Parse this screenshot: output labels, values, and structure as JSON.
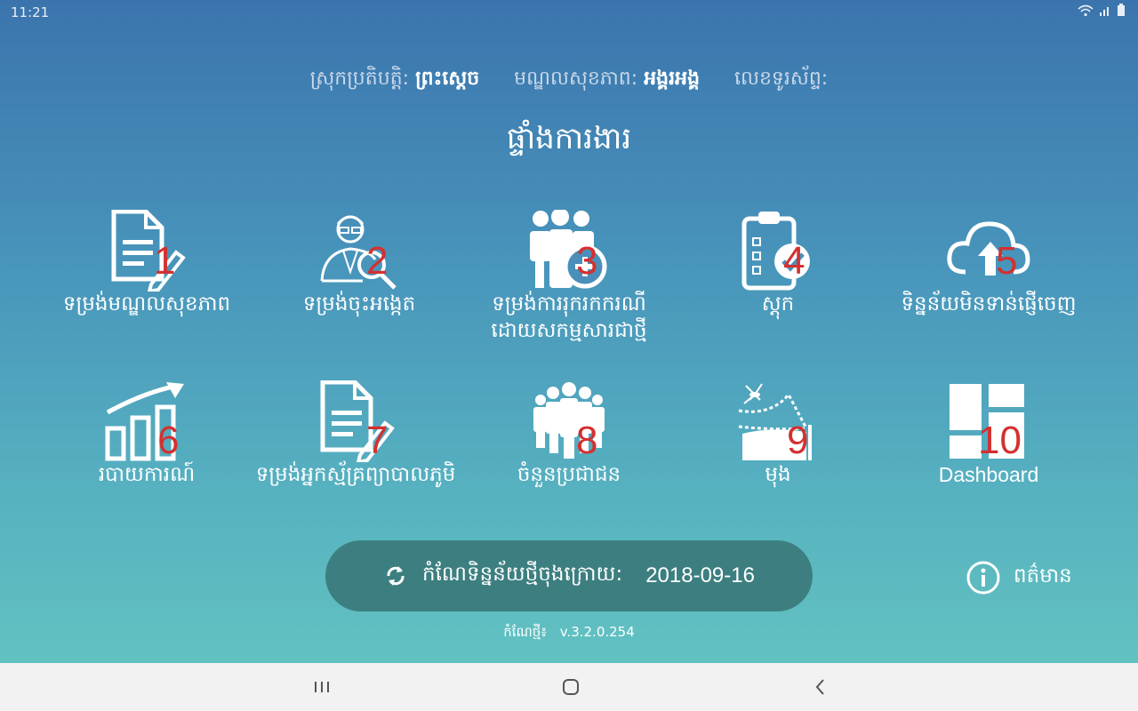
{
  "status_bar": {
    "time": "11:21",
    "icons": [
      "wifi-icon",
      "signal-icon",
      "battery-icon"
    ]
  },
  "info": {
    "district_label": "ស្រុកប្រតិបត្តិ:",
    "district_value": "ព្រះស្ដេច",
    "health_center_label": "មណ្ឌលសុខភាព:",
    "health_center_value": "អង្គរអង្គ",
    "phone_label": "លេខទូរស័ព្ទ:"
  },
  "title": "ផ្ទាំងការងារ",
  "tiles": [
    {
      "number": "1",
      "label": "ទម្រង់មណ្ឌលសុខភាព",
      "icon": "document-edit-icon"
    },
    {
      "number": "2",
      "label": "ទម្រង់ចុះអង្កេត",
      "icon": "investigator-icon"
    },
    {
      "number": "3",
      "label": "ទម្រង់ការរុករកករណីដោយសកម្មសារជាថ្មី",
      "icon": "group-add-icon"
    },
    {
      "number": "4",
      "label": "ស្តុក",
      "icon": "clipboard-check-icon"
    },
    {
      "number": "5",
      "label": "ទិន្នន័យមិនទាន់ផ្ញើចេញ",
      "icon": "cloud-upload-icon"
    },
    {
      "number": "6",
      "label": "របាយការណ៍",
      "icon": "bar-chart-trend-icon"
    },
    {
      "number": "7",
      "label": "ទម្រង់អ្នកស្ម័គ្រព្យាបាលភូមិ",
      "icon": "document-edit-icon"
    },
    {
      "number": "8",
      "label": "ចំនួនប្រជាជន",
      "icon": "people-icon"
    },
    {
      "number": "9",
      "label": "មុង",
      "icon": "mosquito-net-icon"
    },
    {
      "number": "10",
      "label": "Dashboard",
      "icon": "dashboard-icon"
    }
  ],
  "sync": {
    "label": "កំណែទិន្នន័យថ្មីចុងក្រោយ:",
    "date": "2018-09-16",
    "icon": "sync-icon"
  },
  "info_button": {
    "label": "ពត៌មាន",
    "icon": "info-icon"
  },
  "version": {
    "label": "កំណែថ្មី៖",
    "value": "v.3.2.0.254"
  },
  "nav": [
    "recent-apps-icon",
    "home-icon",
    "back-icon"
  ]
}
